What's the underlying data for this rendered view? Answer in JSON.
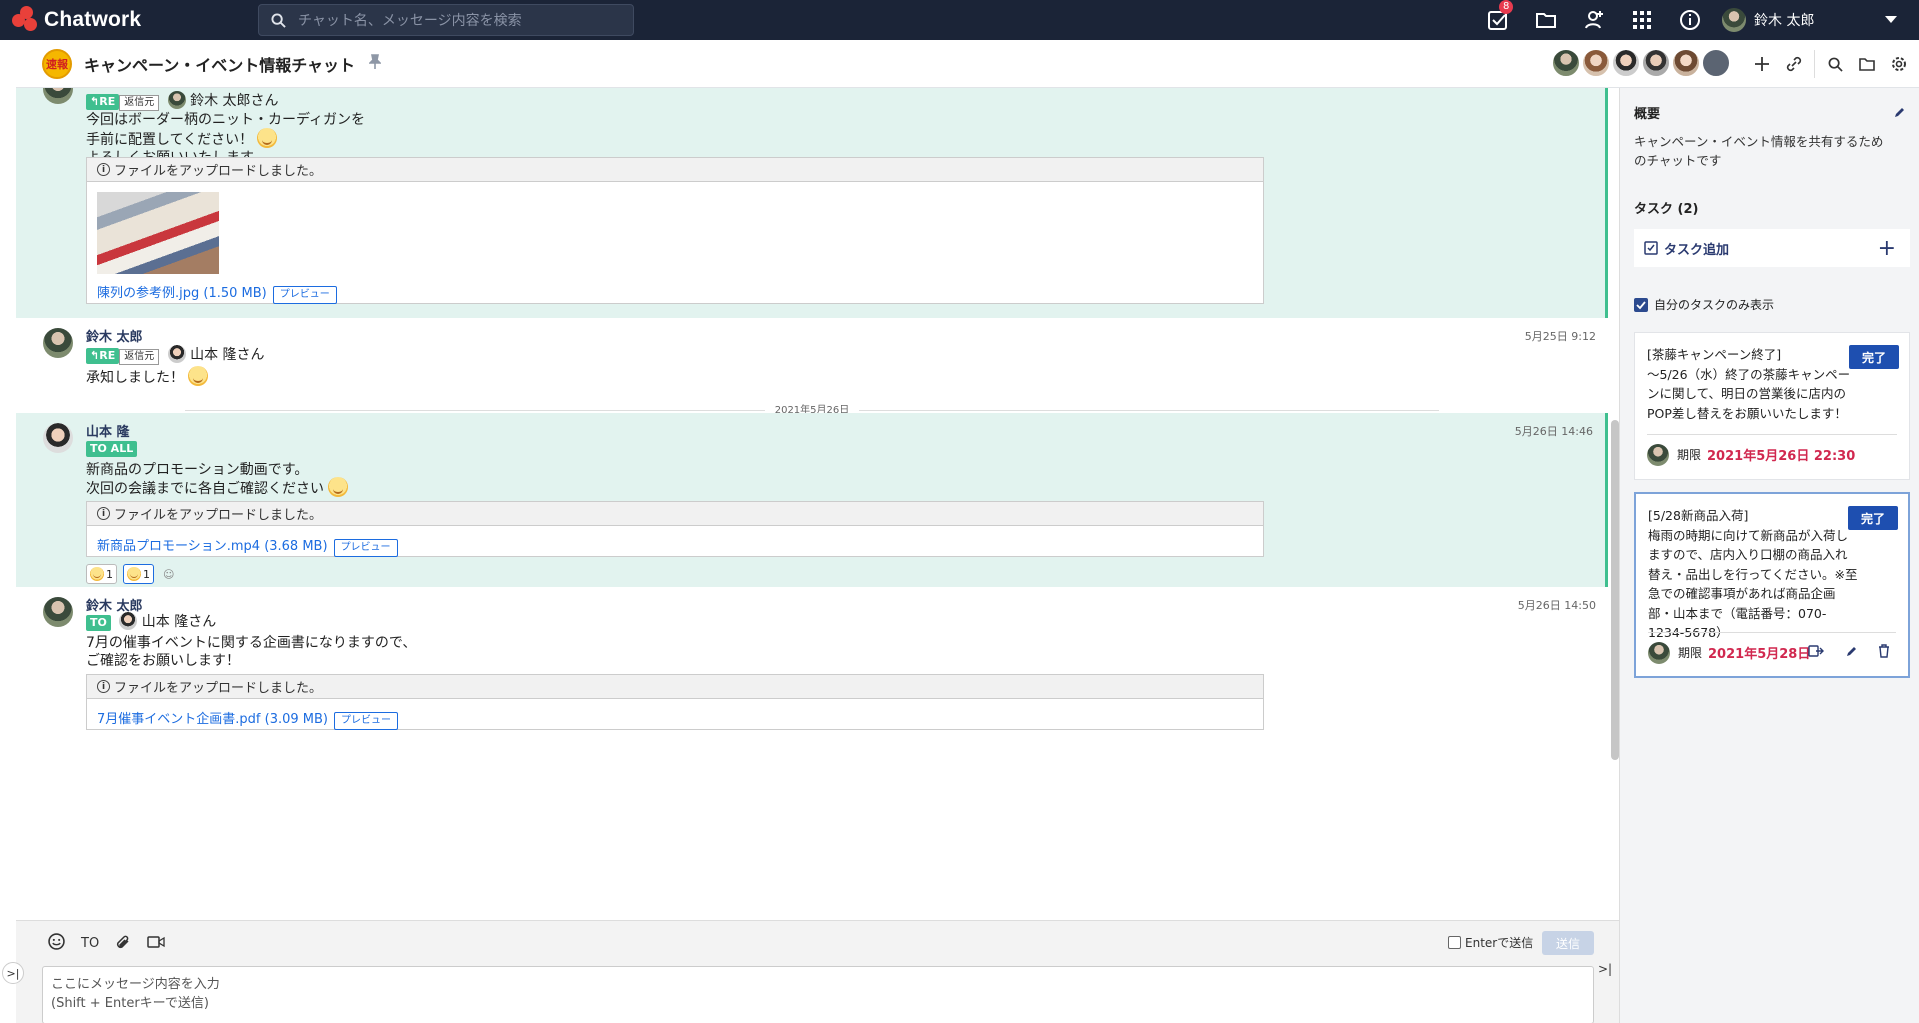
{
  "app": {
    "name": "Chatwork"
  },
  "search": {
    "placeholder": "チャット名、メッセージ内容を検索"
  },
  "topbar": {
    "task_badge": "8",
    "user_name": "鈴木 太郎"
  },
  "room": {
    "title": "キャンペーン・イベント情報チャット",
    "icon_text": "速報"
  },
  "messages": {
    "m1": {
      "re_tag": "RE",
      "src_tag": "返信元",
      "reply_to": "鈴木 太郎さん",
      "lines": [
        "今回はボーダー柄のニット・カーディガンを",
        "手前に配置してください！",
        "よろしくお願いいたします。"
      ],
      "file_head": "ファイルをアップロードしました。",
      "file_name": "陳列の参考例.jpg (1.50 MB)",
      "preview": "プレビュー"
    },
    "m2": {
      "name": "鈴木 太郎",
      "time": "5月25日 9:12",
      "re_tag": "RE",
      "src_tag": "返信元",
      "reply_to": "山本 隆さん",
      "lines": [
        "承知しました！"
      ]
    },
    "date_sep": "2021年5月26日",
    "m3": {
      "name": "山本 隆",
      "time": "5月26日 14:46",
      "to_all": "TO ALL",
      "lines": [
        "新商品のプロモーション動画です。",
        "次回の会議までに各自ご確認ください"
      ],
      "file_head": "ファイルをアップロードしました。",
      "file_name": "新商品プロモーション.mp4 (3.68 MB)",
      "preview": "プレビュー",
      "reactions": [
        "1",
        "1"
      ]
    },
    "m4": {
      "name": "鈴木 太郎",
      "time": "5月26日 14:50",
      "to_tag": "TO",
      "to_name": "山本 隆さん",
      "lines": [
        "7月の催事イベントに関する企画書になりますので、",
        "ご確認をお願いします！"
      ],
      "file_head": "ファイルをアップロードしました。",
      "file_name": "7月催事イベント企画書.pdf (3.09 MB)",
      "preview": "プレビュー"
    }
  },
  "compose": {
    "to_label": "TO",
    "enter_send": "Enterで送信",
    "send": "送信",
    "placeholder_1": "ここにメッセージ内容を入力",
    "placeholder_2": "(Shift + Enterキーで送信)"
  },
  "panel": {
    "overview_title": "概要",
    "overview_desc": "キャンペーン・イベント情報を共有するためのチャットです",
    "task_title": "タスク (2)",
    "task_add": "タスク追加",
    "own_only": "自分のタスクのみ表示",
    "tasks": [
      {
        "text": "[茶藤キャンペーン終了]\n～5/26（水）終了の茶藤キャンペーンに関して、明日の営業後に店内のPOP差し替えをお願いいたします！",
        "done": "完了",
        "due_label": "期限",
        "due": "2021年5月26日 22:30"
      },
      {
        "text": "[5/28新商品入荷]\n梅雨の時期に向けて新商品が入荷しますので、店内入り口棚の商品入れ替え・品出しを行ってください。※至急での確認事項があれば商品企画部・山本まで（電話番号：070-1234-5678）",
        "done": "完了",
        "due_label": "期限",
        "due": "2021年5月28日"
      }
    ]
  },
  "colors": {
    "topbar": "#1b2437",
    "accent_green": "#3fbf8f",
    "highlight_bg": "#e2f3ef",
    "link": "#1c6ce0",
    "due": "#d1284f",
    "done_btn": "#1e4fb0"
  }
}
